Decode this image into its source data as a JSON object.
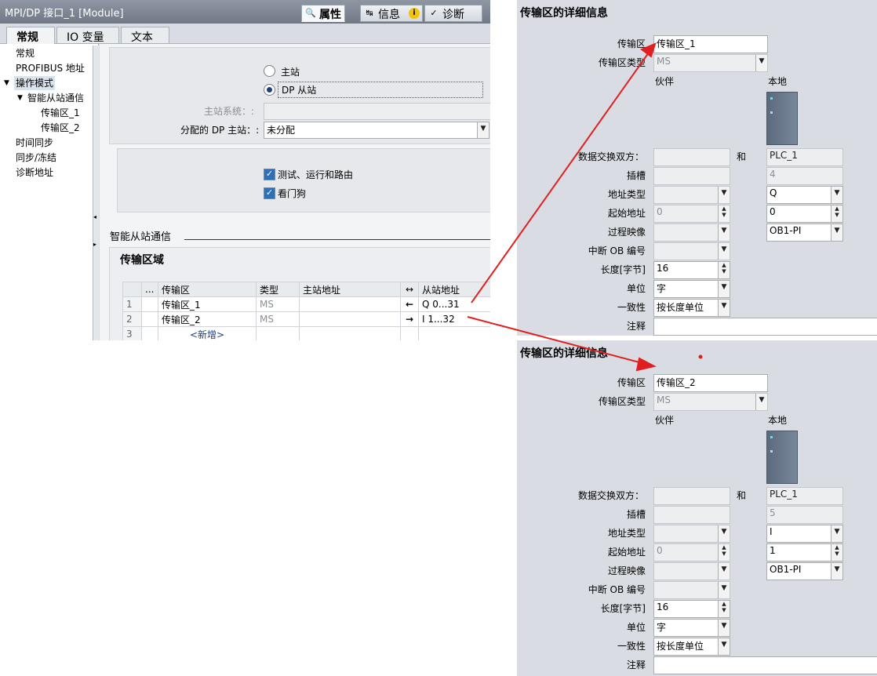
{
  "window": {
    "title": "MPI/DP 接口_1 [Module]",
    "panel_tabs": [
      {
        "label": "属性",
        "icon": "properties-icon"
      },
      {
        "label": "信息",
        "icon": "info-icon"
      },
      {
        "label": "诊断",
        "icon": "diagnostics-icon"
      }
    ],
    "sub_tabs": [
      "常规",
      "IO 变量",
      "文本"
    ]
  },
  "nav": {
    "items": [
      "常规",
      "PROFIBUS 地址",
      "操作模式",
      "智能从站通信",
      "传输区_1",
      "传输区_2",
      "时间同步",
      "同步/冻结",
      "诊断地址"
    ]
  },
  "mode": {
    "radio_master": "主站",
    "radio_slave": "DP 从站",
    "master_system_label": "主站系统：:",
    "assigned_master_label": "分配的 DP 主站：:",
    "assigned_master_value": "未分配",
    "check_test": "测试、运行和路由",
    "check_watchdog": "看门狗"
  },
  "smart": {
    "section_label": "智能从站通信",
    "area_title": "传输区域",
    "columns": [
      "...",
      "传输区",
      "类型",
      "主站地址",
      "↔",
      "从站地址"
    ],
    "rows": [
      {
        "num": "1",
        "name": "传输区_1",
        "type": "MS",
        "master": "",
        "arrow": "←",
        "slave": "Q 0...31"
      },
      {
        "num": "2",
        "name": "传输区_2",
        "type": "MS",
        "master": "",
        "arrow": "→",
        "slave": "I 1...32"
      },
      {
        "num": "3",
        "name": "<新增>",
        "type": "",
        "master": "",
        "arrow": "",
        "slave": ""
      }
    ]
  },
  "details": [
    {
      "title": "传输区的详细信息",
      "area_label": "传输区",
      "area_value": "传输区_1",
      "type_label": "传输区类型",
      "type_value": "MS",
      "partner": "伙伴",
      "local": "本地",
      "exchange_label": "数据交换双方：",
      "and": "和",
      "local_device": "PLC_1",
      "slot_label": "插槽",
      "slot_value": "4",
      "addr_type_label": "地址类型",
      "addr_type_value": "Q",
      "start_label": "起始地址",
      "start_partner": "0",
      "start_value": "0",
      "image_label": "过程映像",
      "image_value": "OB1-PI",
      "ob_label": "中断 OB 编号",
      "length_label": "长度[字节]",
      "length_value": "16",
      "unit_label": "单位",
      "unit_value": "字",
      "consistency_label": "一致性",
      "consistency_value": "按长度单位",
      "comment_label": "注释",
      "comment_value": ""
    },
    {
      "title": "传输区的详细信息",
      "area_label": "传输区",
      "area_value": "传输区_2",
      "type_label": "传输区类型",
      "type_value": "MS",
      "partner": "伙伴",
      "local": "本地",
      "exchange_label": "数据交换双方：",
      "and": "和",
      "local_device": "PLC_1",
      "slot_label": "插槽",
      "slot_value": "5",
      "addr_type_label": "地址类型",
      "addr_type_value": "I",
      "start_label": "起始地址",
      "start_partner": "0",
      "start_value": "1",
      "image_label": "过程映像",
      "image_value": "OB1-PI",
      "ob_label": "中断 OB 编号",
      "length_label": "长度[字节]",
      "length_value": "16",
      "unit_label": "单位",
      "unit_value": "字",
      "consistency_label": "一致性",
      "consistency_value": "按长度单位",
      "comment_label": "注释",
      "comment_value": ""
    }
  ],
  "colors": {
    "annotation_arrow": "#e02020",
    "selection": "#d8e3ee",
    "accent": "#1f3f79"
  }
}
